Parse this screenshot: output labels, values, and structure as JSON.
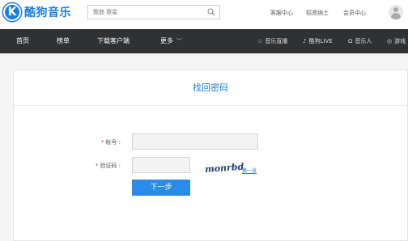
{
  "header": {
    "logo_letter": "K",
    "logo_text": "酷狗音乐",
    "search_placeholder": "歌曲 歌星",
    "links": [
      "客服中心",
      "招贤纳士",
      "会员中心"
    ],
    "avatar_icon": "user-avatar-icon"
  },
  "nav": {
    "items": [
      "首页",
      "榜单",
      "下载客户端",
      "更多"
    ],
    "right_items": [
      {
        "icon": "star-icon",
        "glyph": "☆",
        "label": "音乐直播"
      },
      {
        "icon": "note-icon",
        "glyph": "♪",
        "label": "酷狗LIVE"
      },
      {
        "icon": "headphones-icon",
        "glyph": "Ω",
        "label": "音乐人"
      },
      {
        "icon": "gamepad-icon",
        "glyph": "◎",
        "label": "游戏"
      }
    ]
  },
  "form": {
    "title": "找回密码",
    "account_label": "帐号 :",
    "account_value": "",
    "captcha_label": "验证码 :",
    "captcha_value": "",
    "captcha_text": "monrbd",
    "refresh_label": "换一张",
    "next_button": "下一步",
    "required_mark": "*"
  },
  "colors": {
    "brand": "#1a7fe0",
    "nav_bg": "#303133",
    "button": "#2b8ce8"
  }
}
